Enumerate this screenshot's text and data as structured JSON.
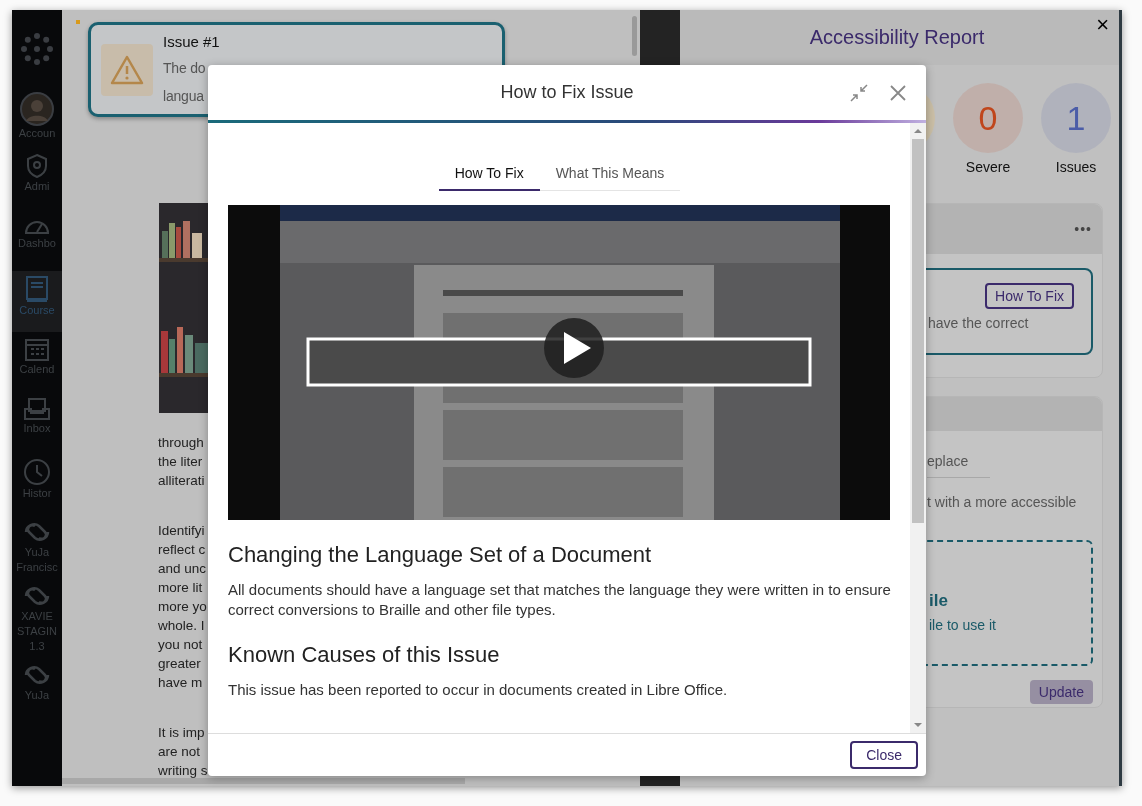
{
  "sidebar": {
    "items": [
      {
        "kind": "avatar",
        "lines": [
          "Accoun"
        ],
        "selected": false
      },
      {
        "kind": "shield",
        "lines": [
          "Admi"
        ],
        "selected": false
      },
      {
        "kind": "gauge",
        "lines": [
          "Dashbo"
        ],
        "selected": false
      },
      {
        "kind": "book",
        "lines": [
          "Course"
        ],
        "selected": true
      },
      {
        "kind": "calendar",
        "lines": [
          "Calend"
        ],
        "selected": false
      },
      {
        "kind": "inbox",
        "lines": [
          "Inbox"
        ],
        "selected": false
      },
      {
        "kind": "clock",
        "lines": [
          "Histor"
        ],
        "selected": false
      },
      {
        "kind": "loop",
        "lines": [
          "YuJa",
          "Francisc"
        ],
        "selected": false
      },
      {
        "kind": "loop",
        "lines": [
          "XAVIE",
          "STAGIN",
          "1.3"
        ],
        "selected": false
      },
      {
        "kind": "loop",
        "lines": [
          "YuJa"
        ],
        "selected": false
      }
    ]
  },
  "page": {
    "issue_card": {
      "title": "Issue #1",
      "lines": [
        "The do",
        "langua"
      ]
    },
    "paragraphs": [
      [
        "through",
        "the liter",
        "alliterati"
      ],
      [
        "Identifyi",
        "reflect c",
        "and unc",
        "more lit",
        "more yo",
        "whole. I",
        "you not",
        "greater",
        "have m"
      ],
      [
        "It is imp",
        "are not",
        "writing s"
      ]
    ]
  },
  "report": {
    "title": "Accessibility Report",
    "close": "×",
    "stats": [
      {
        "value": "0",
        "label": "Severe",
        "color": "#c0461c"
      },
      {
        "value": "1",
        "label": "Issues",
        "color": "#4b5ca8"
      }
    ],
    "issue": {
      "menu": "•••",
      "button": "How To Fix",
      "text": "have the correct"
    },
    "fix": {
      "tab": "eplace",
      "text": "t with a more accessible",
      "drop_title": "ile",
      "drop_text": "ile to use it",
      "button": "Update"
    }
  },
  "modal": {
    "title": "How to Fix Issue",
    "tabs": [
      {
        "label": "How To Fix",
        "selected": true
      },
      {
        "label": "What This Means",
        "selected": false
      }
    ],
    "sections": [
      {
        "heading": "Changing the Language Set of a Document",
        "text": "All documents should have a language set that matches the language they were written in to ensure correct conversions to Braille and other file types."
      },
      {
        "heading": "Known Causes of this Issue",
        "text": "This issue has been reported to occur in documents created in Libre Office."
      }
    ],
    "close_button": "Close"
  }
}
